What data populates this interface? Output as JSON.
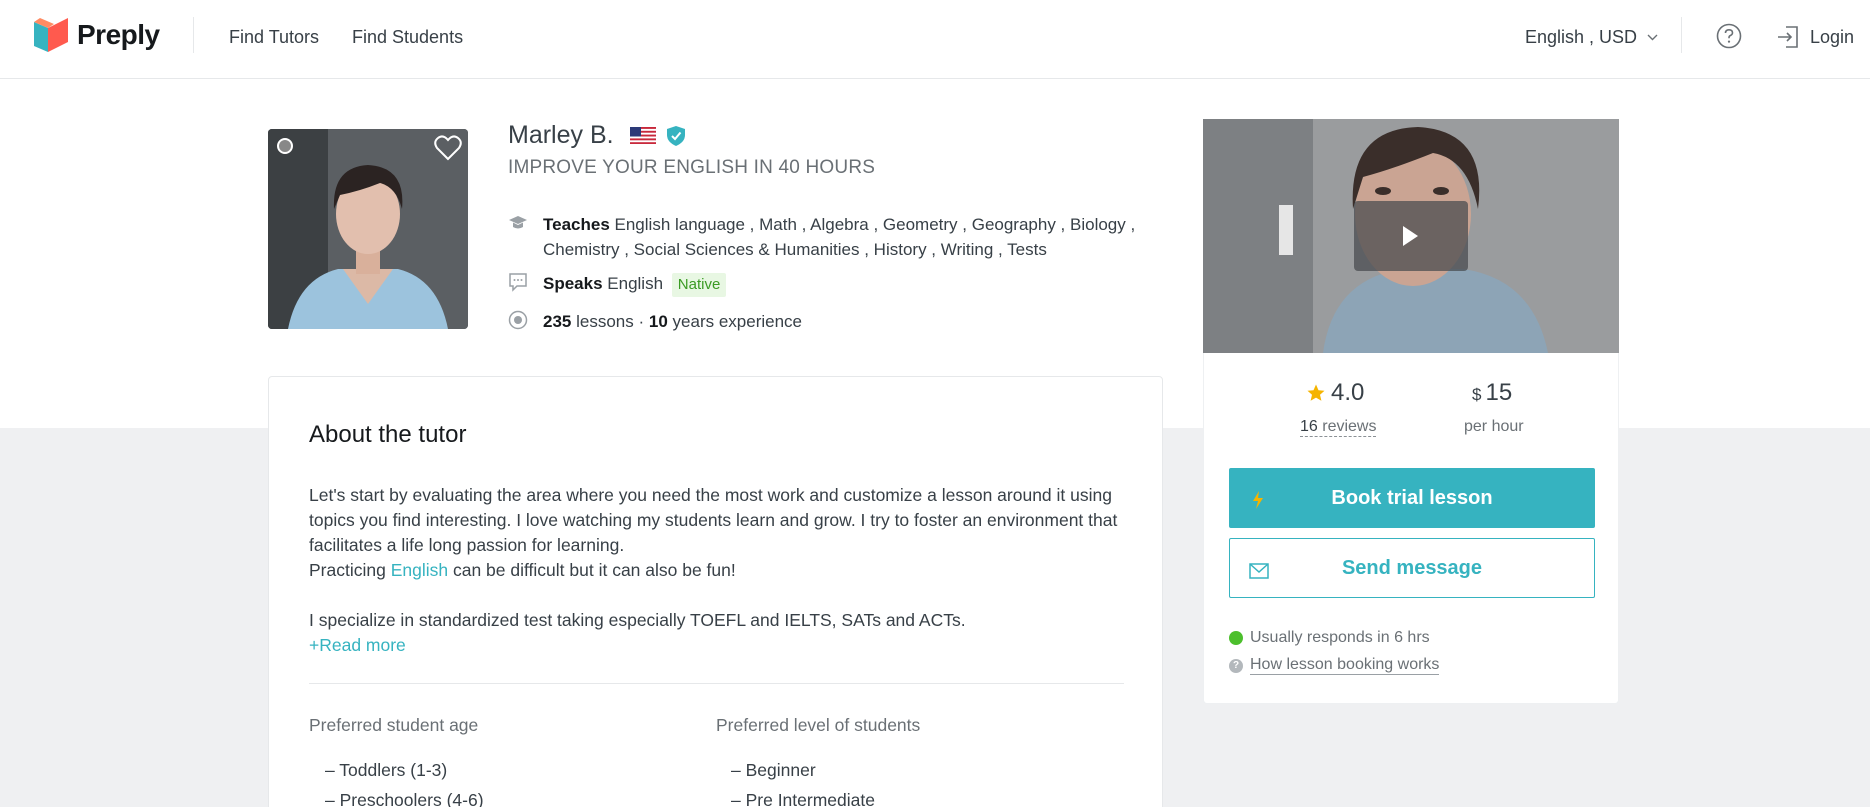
{
  "header": {
    "brand": "Preply",
    "nav": [
      "Find Tutors",
      "Find Students"
    ],
    "language_currency": "English , USD",
    "login": "Login"
  },
  "tutor": {
    "name": "Marley B.",
    "headline": "IMPROVE YOUR ENGLISH IN 40 HOURS",
    "teaches_label": "Teaches",
    "teaches_line1": "English language , Math , Algebra , Geometry , Geography , Biology ,",
    "teaches_line2": "Chemistry , Social Sciences & Humanities , History , Writing , Tests",
    "speaks_label": "Speaks",
    "speaks_language": "English",
    "speaks_level": "Native",
    "lessons": "235",
    "lessons_label": "lessons ·",
    "years": "10",
    "years_label": "years experience"
  },
  "about": {
    "title": "About the tutor",
    "para1": "Let's start by evaluating the area where you need the most work and customize a lesson around it using topics you find interesting. I love watching my students learn and grow. I try to foster an environment that facilitates a life long passion for learning.",
    "para2_prefix": "Practicing ",
    "para2_link": "English",
    "para2_suffix": " can be difficult but it can also be fun!",
    "para3": "I specialize in standardized test taking especially TOEFL and IELTS, SATs and ACTs.",
    "read_more": "+Read more",
    "age_title": "Preferred student age",
    "age_items": [
      "– Toddlers (1-3)",
      "– Preschoolers (4-6)"
    ],
    "level_title": "Preferred level of students",
    "level_items": [
      "– Beginner",
      "– Pre Intermediate"
    ]
  },
  "booking": {
    "rating": "4.0",
    "reviews_count": "16",
    "reviews_label": "reviews",
    "currency_symbol": "$",
    "price": "15",
    "per_hour": "per hour",
    "book_label": "Book trial lesson",
    "message_label": "Send message",
    "responds": "Usually responds in 6 hrs",
    "how_it_works": "How lesson booking works"
  },
  "colors": {
    "accent": "#36b3c0",
    "native_badge_bg": "#e8f7e3",
    "native_badge_text": "#3b9b24",
    "online_dot": "#4cbf2c",
    "star": "#f5b400"
  },
  "icons": [
    "preply-logo-icon",
    "chevron-down-icon",
    "help-icon",
    "login-icon",
    "heart-icon",
    "us-flag-icon",
    "verified-shield-icon",
    "graduation-cap-icon",
    "chat-bubble-icon",
    "lessons-icon",
    "play-icon",
    "star-icon",
    "bolt-icon",
    "mail-icon"
  ]
}
